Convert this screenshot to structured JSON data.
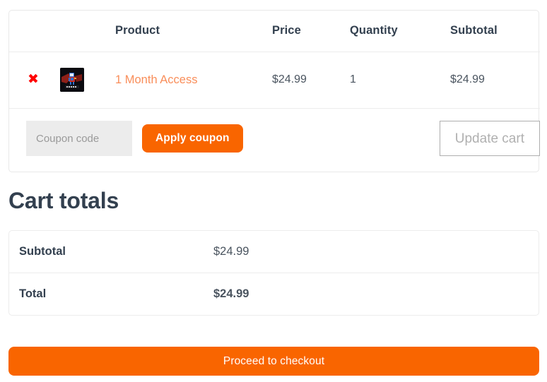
{
  "cart_table": {
    "headers": {
      "remove": "",
      "thumbnail": "",
      "product": "Product",
      "price": "Price",
      "quantity": "Quantity",
      "subtotal": "Subtotal"
    },
    "items": [
      {
        "remove_icon": "remove-item-icon",
        "remove_glyph": "✖",
        "thumbnail_icon": "product-thumbnail-image",
        "name": "1 Month Access",
        "price": "$24.99",
        "quantity": "1",
        "subtotal": "$24.99"
      }
    ],
    "coupon": {
      "placeholder": "Coupon code",
      "value": "",
      "apply_label": "Apply coupon"
    },
    "update_cart_label": "Update cart"
  },
  "totals": {
    "heading": "Cart totals",
    "rows": [
      {
        "label": "Subtotal",
        "value": "$24.99"
      },
      {
        "label": "Total",
        "value": "$24.99"
      }
    ]
  },
  "checkout": {
    "label": "Proceed to checkout"
  },
  "colors": {
    "accent_orange": "#f96500",
    "product_link": "#f98e5a",
    "remove_red": "#ff0000",
    "heading_navy": "#33404f",
    "body_text": "#4a545f",
    "border": "#ececec",
    "input_bg": "#ececec",
    "disabled_border": "#aeaeae",
    "disabled_text": "#b0b0b0"
  }
}
